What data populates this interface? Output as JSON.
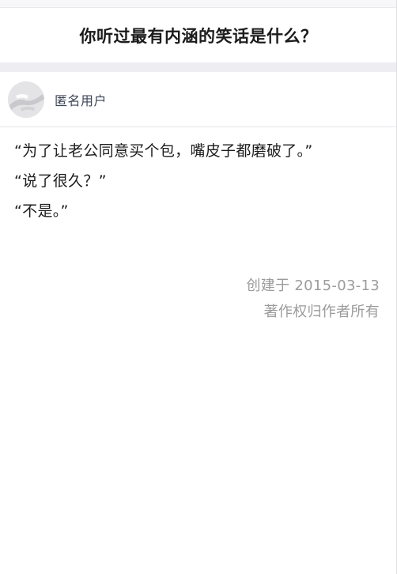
{
  "question": {
    "title": "你听过最有内涵的笑话是什么？"
  },
  "author": {
    "name": "匿名用户",
    "avatar_icon": "anonymous-avatar-icon"
  },
  "answer": {
    "lines": [
      "“为了让老公同意买个包，嘴皮子都磨破了。”",
      "“说了很久？”",
      "“不是。”"
    ],
    "created": "创建于 2015-03-13",
    "copyright": "著作权归作者所有"
  },
  "colors": {
    "meta_text": "#9b9b9b",
    "author_text": "#3d4656",
    "separator_band": "#ededf2"
  }
}
